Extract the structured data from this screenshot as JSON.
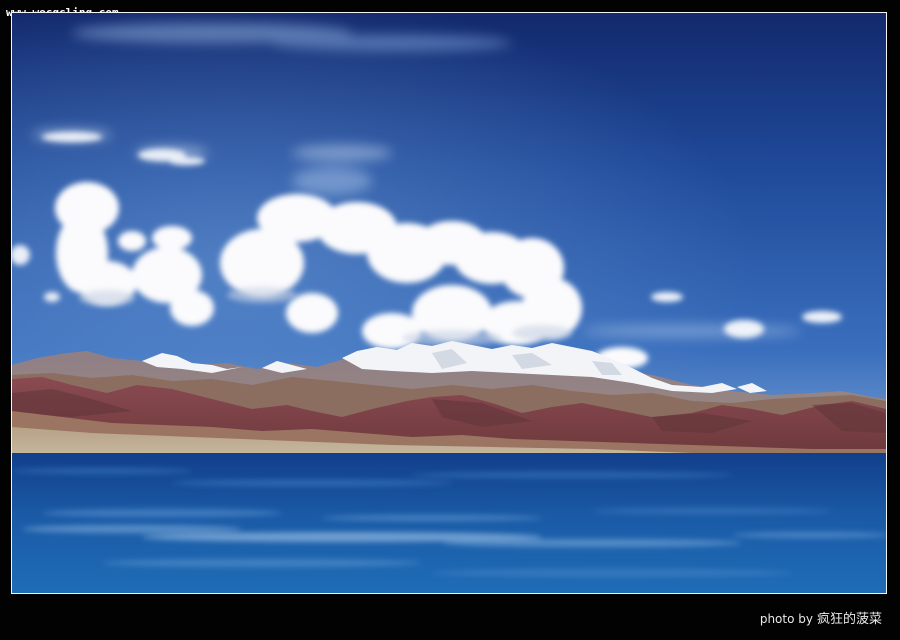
{
  "watermark": {
    "text": "www.wecgcling.com"
  },
  "credit": {
    "prefix": "photo by",
    "author": "疯狂的菠菜"
  },
  "colors": {
    "sky_top": "#142f78",
    "sky_mid": "#2d5fb0",
    "sky_horizon": "#6a93cc",
    "lake_deep": "#0e3a82",
    "lake_light": "#2a6fb8",
    "mountain_red": "#7a3f42",
    "mountain_brown": "#8a6a5c",
    "snow": "#f2f4f8",
    "cloud": "#fbfbfd",
    "shore": "#b9a98f"
  }
}
